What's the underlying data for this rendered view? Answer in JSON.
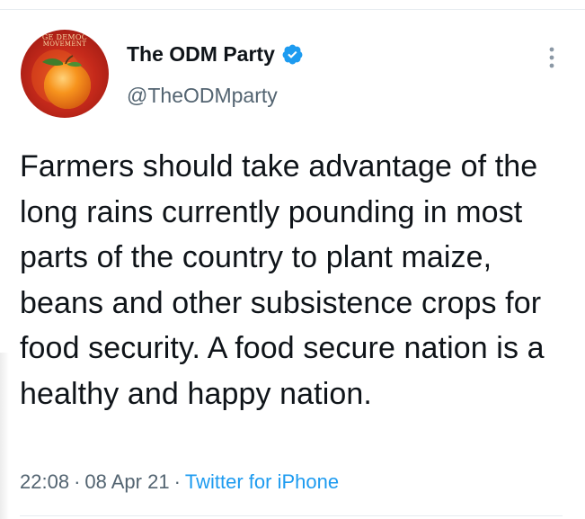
{
  "author": {
    "display_name": "The ODM Party",
    "handle": "@TheODMparty",
    "verified": true,
    "avatar": {
      "line1": "GE DEMOC",
      "line2": "MOVEMENT",
      "icon": "orange-fruit"
    }
  },
  "tweet": {
    "text": "Farmers should take advantage of the long rains currently pounding in most parts of the country to plant maize, beans and other subsistence crops for food security. A food secure nation is a healthy and happy nation."
  },
  "meta": {
    "time": "22:08",
    "separator": "·",
    "date": "08 Apr 21",
    "source": "Twitter for iPhone"
  },
  "colors": {
    "text": "#0f1419",
    "secondary": "#536471",
    "link": "#1d9bf0",
    "verified": "#1d9bf0",
    "divider": "#e6ecf0"
  },
  "icons": {
    "more": "more-vertical-icon",
    "verified": "verified-badge-icon"
  }
}
